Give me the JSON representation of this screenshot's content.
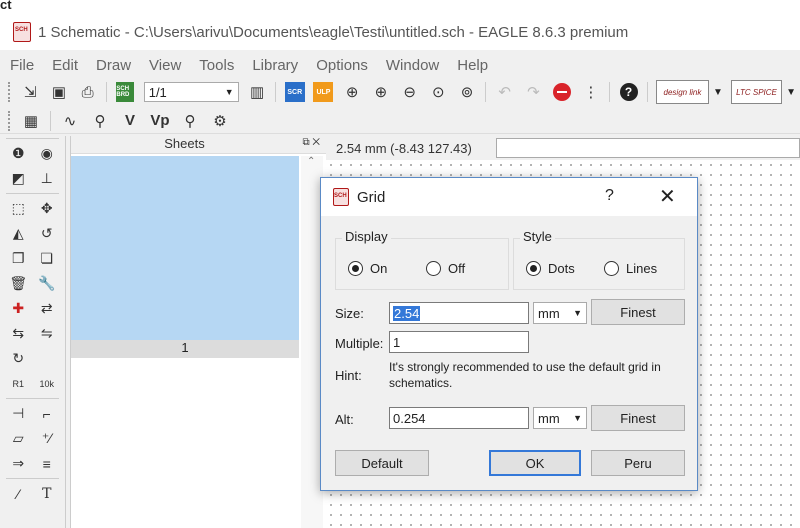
{
  "top_strip": {
    "text": "ct"
  },
  "window": {
    "title": "1 Schematic - C:\\Users\\arivu\\Documents\\eagle\\Testi\\untitled.sch - EAGLE 8.6.3 premium"
  },
  "menu": [
    "File",
    "Edit",
    "Draw",
    "View",
    "Tools",
    "Library",
    "Options",
    "Window",
    "Help"
  ],
  "toolbar": {
    "sheet_combo_value": "1/1",
    "scr_badge": "SCR",
    "ulp_badge": "ULP",
    "sch_brd_badge": "SCH BRD",
    "designlink_label": "design link",
    "ltspice_label": "LTC SPICE"
  },
  "toolbar2": {
    "value_label": "V",
    "value_p_label": "Vp"
  },
  "sheets_panel": {
    "header": "Sheets",
    "sheet_number": "1"
  },
  "coord_display": "2.54 mm (-8.43 127.43)",
  "left_toolbar": {
    "text_tool": "T"
  },
  "grid_dialog": {
    "title": "Grid",
    "help": "?",
    "close": "✕",
    "display_group": {
      "label": "Display",
      "on": "On",
      "off": "Off",
      "selected": "On"
    },
    "style_group": {
      "label": "Style",
      "dots": "Dots",
      "lines": "Lines",
      "selected": "Dots"
    },
    "size": {
      "label": "Size:",
      "value": "2.54",
      "unit": "mm",
      "finest": "Finest"
    },
    "multiple": {
      "label": "Multiple:",
      "value": "1"
    },
    "hint": {
      "label": "Hint:",
      "text": "It's strongly recommended to use the default grid in schematics."
    },
    "alt": {
      "label": "Alt:",
      "value": "0.254",
      "unit": "mm",
      "finest": "Finest"
    },
    "buttons": {
      "default": "Default",
      "ok": "OK",
      "peru": "Peru"
    }
  }
}
